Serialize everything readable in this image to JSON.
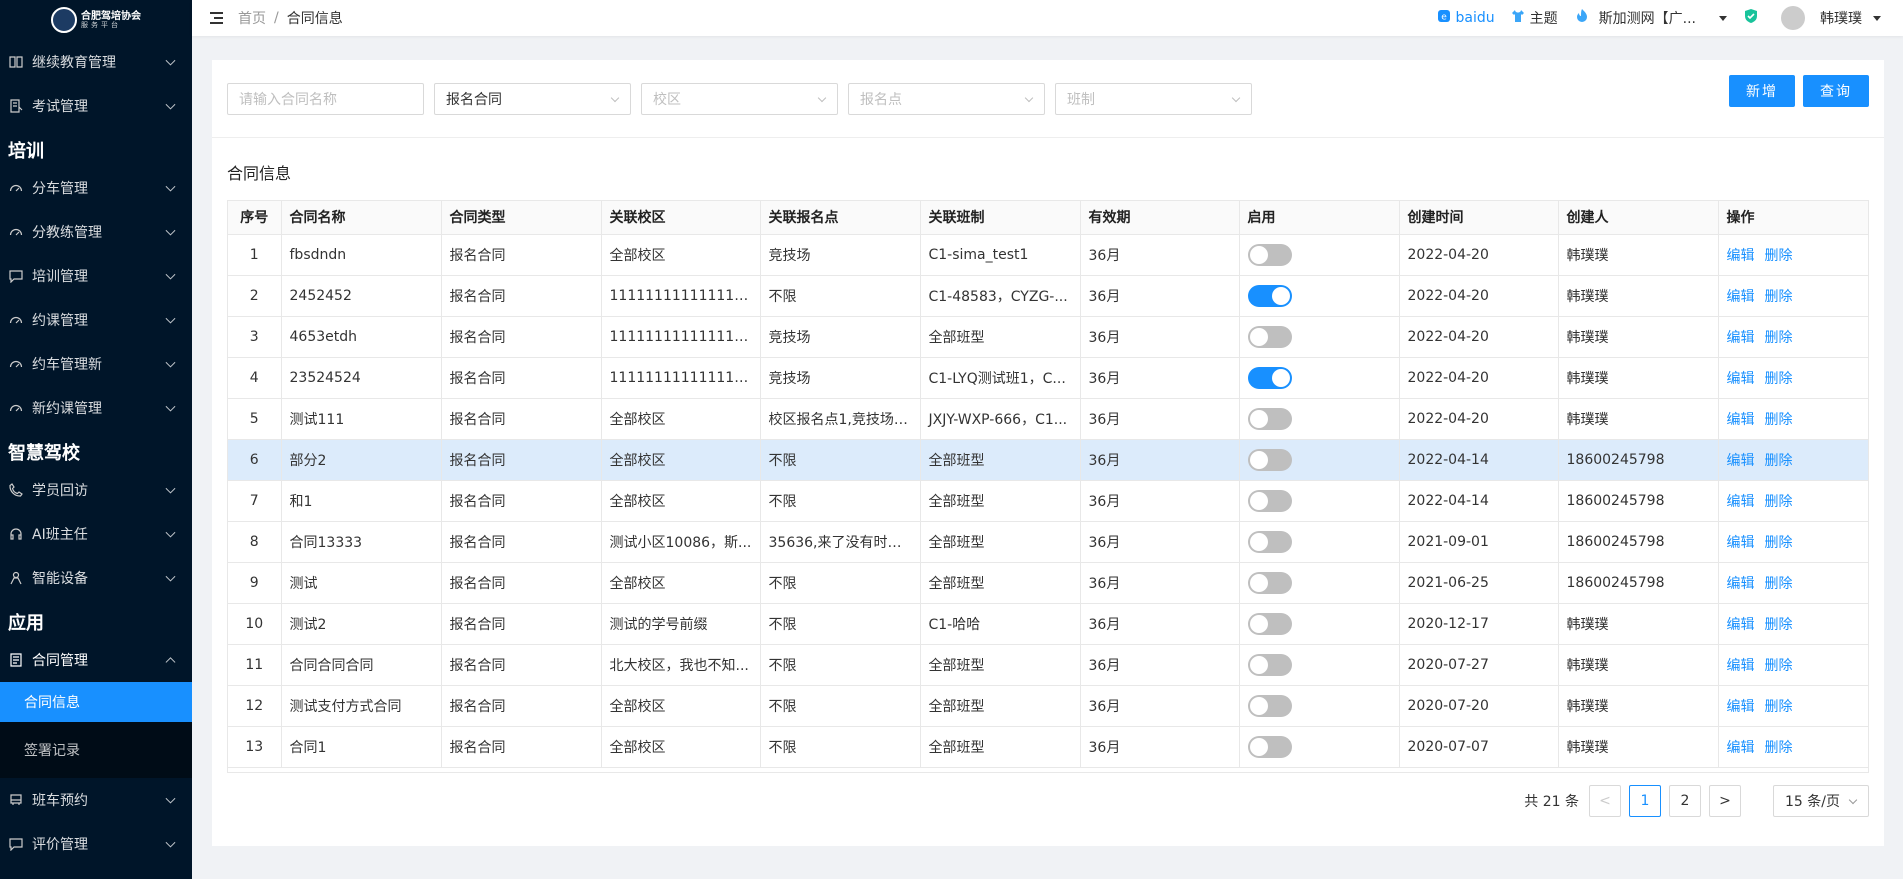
{
  "logo": {
    "title": "合肥驾培协会",
    "subtitle": "服务平台"
  },
  "sidebar": {
    "top_items": [
      {
        "label": "继续教育管理",
        "icon": "book-icon"
      },
      {
        "label": "考试管理",
        "icon": "exam-icon"
      }
    ],
    "groups": [
      {
        "title": "培训",
        "items": [
          {
            "label": "分车管理",
            "icon": "dashboard-icon"
          },
          {
            "label": "分教练管理",
            "icon": "dashboard-icon"
          },
          {
            "label": "培训管理",
            "icon": "message-icon"
          },
          {
            "label": "约课管理",
            "icon": "dashboard-icon"
          },
          {
            "label": "约车管理新",
            "icon": "dashboard-icon"
          },
          {
            "label": "新约课管理",
            "icon": "dashboard-icon"
          }
        ]
      },
      {
        "title": "智慧驾校",
        "items": [
          {
            "label": "学员回访",
            "icon": "phone-icon"
          },
          {
            "label": "AI班主任",
            "icon": "headset-icon"
          },
          {
            "label": "智能设备",
            "icon": "device-icon"
          }
        ]
      },
      {
        "title": "应用",
        "items": [
          {
            "label": "合同管理",
            "icon": "contract-icon"
          }
        ]
      }
    ],
    "submenu": [
      {
        "label": "合同信息"
      },
      {
        "label": "签署记录"
      }
    ],
    "bottom_items": [
      {
        "label": "班车预约",
        "icon": "bus-icon"
      },
      {
        "label": "评价管理",
        "icon": "message-icon"
      }
    ]
  },
  "header": {
    "breadcrumb": [
      "首页",
      "合同信息"
    ],
    "baidu": "baidu",
    "theme": "主题",
    "org": "斯加测网【广...",
    "user": "韩璞璞"
  },
  "filters": {
    "contract_name_placeholder": "请输入合同名称",
    "contract_type": "报名合同",
    "campus_placeholder": "校区",
    "signup_point_placeholder": "报名点",
    "class_placeholder": "班制"
  },
  "buttons": {
    "add": "新增",
    "query": "查询"
  },
  "section_title": "合同信息",
  "table": {
    "columns": [
      "序号",
      "合同名称",
      "合同类型",
      "关联校区",
      "关联报名点",
      "关联班制",
      "有效期",
      "启用",
      "创建时间",
      "创建人",
      "操作"
    ],
    "edit_label": "编辑",
    "delete_label": "删除",
    "rows": [
      {
        "no": "1",
        "name": "fbsdndn",
        "type": "报名合同",
        "campus": "全部校区",
        "point": "竞技场",
        "class": "C1-sima_test1",
        "validity": "36月",
        "enabled": false,
        "created": "2022-04-20",
        "creator": "韩璞璞"
      },
      {
        "no": "2",
        "name": "2452452",
        "type": "报名合同",
        "campus": "1111111111111111...",
        "point": "不限",
        "class": "C1-48583，CYZG-...",
        "validity": "36月",
        "enabled": true,
        "created": "2022-04-20",
        "creator": "韩璞璞"
      },
      {
        "no": "3",
        "name": "4653etdh",
        "type": "报名合同",
        "campus": "1111111111111111...",
        "point": "竞技场",
        "class": "全部班型",
        "validity": "36月",
        "enabled": false,
        "created": "2022-04-20",
        "creator": "韩璞璞"
      },
      {
        "no": "4",
        "name": "23524524",
        "type": "报名合同",
        "campus": "1111111111111111...",
        "point": "竞技场",
        "class": "C1-LYQ测试班1，C...",
        "validity": "36月",
        "enabled": true,
        "created": "2022-04-20",
        "creator": "韩璞璞"
      },
      {
        "no": "5",
        "name": "测试111",
        "type": "报名合同",
        "campus": "全部校区",
        "point": "校区报名点1,竞技场,...",
        "class": "JXJY-WXP-666，C1...",
        "validity": "36月",
        "enabled": false,
        "created": "2022-04-20",
        "creator": "韩璞璞"
      },
      {
        "no": "6",
        "name": "部分2",
        "type": "报名合同",
        "campus": "全部校区",
        "point": "不限",
        "class": "全部班型",
        "validity": "36月",
        "enabled": false,
        "created": "2022-04-14",
        "creator": "18600245798"
      },
      {
        "no": "7",
        "name": "和1",
        "type": "报名合同",
        "campus": "全部校区",
        "point": "不限",
        "class": "全部班型",
        "validity": "36月",
        "enabled": false,
        "created": "2022-04-14",
        "creator": "18600245798"
      },
      {
        "no": "8",
        "name": "合同13333",
        "type": "报名合同",
        "campus": "测试小区10086，斯...",
        "point": "35636,来了没有时间...",
        "class": "全部班型",
        "validity": "36月",
        "enabled": false,
        "created": "2021-09-01",
        "creator": "18600245798"
      },
      {
        "no": "9",
        "name": "测试",
        "type": "报名合同",
        "campus": "全部校区",
        "point": "不限",
        "class": "全部班型",
        "validity": "36月",
        "enabled": false,
        "created": "2021-06-25",
        "creator": "18600245798"
      },
      {
        "no": "10",
        "name": "测试2",
        "type": "报名合同",
        "campus": "测试的学号前缀",
        "point": "不限",
        "class": "C1-哈哈",
        "validity": "36月",
        "enabled": false,
        "created": "2020-12-17",
        "creator": "韩璞璞"
      },
      {
        "no": "11",
        "name": "合同合同合同",
        "type": "报名合同",
        "campus": "北大校区，我也不知...",
        "point": "不限",
        "class": "全部班型",
        "validity": "36月",
        "enabled": false,
        "created": "2020-07-27",
        "creator": "韩璞璞"
      },
      {
        "no": "12",
        "name": "测试支付方式合同",
        "type": "报名合同",
        "campus": "全部校区",
        "point": "不限",
        "class": "全部班型",
        "validity": "36月",
        "enabled": false,
        "created": "2020-07-20",
        "creator": "韩璞璞"
      },
      {
        "no": "13",
        "name": "合同1",
        "type": "报名合同",
        "campus": "全部校区",
        "point": "不限",
        "class": "全部班型",
        "validity": "36月",
        "enabled": false,
        "created": "2020-07-07",
        "creator": "韩璞璞"
      }
    ]
  },
  "pagination": {
    "total_text": "共 21 条",
    "pages": [
      "1",
      "2"
    ],
    "current": "1",
    "prev": "<",
    "next": ">",
    "page_size": "15 条/页"
  },
  "colors": {
    "sidebar_bg": "#001529",
    "accent": "#1890ff",
    "row_highlight": "#dcebfb"
  }
}
